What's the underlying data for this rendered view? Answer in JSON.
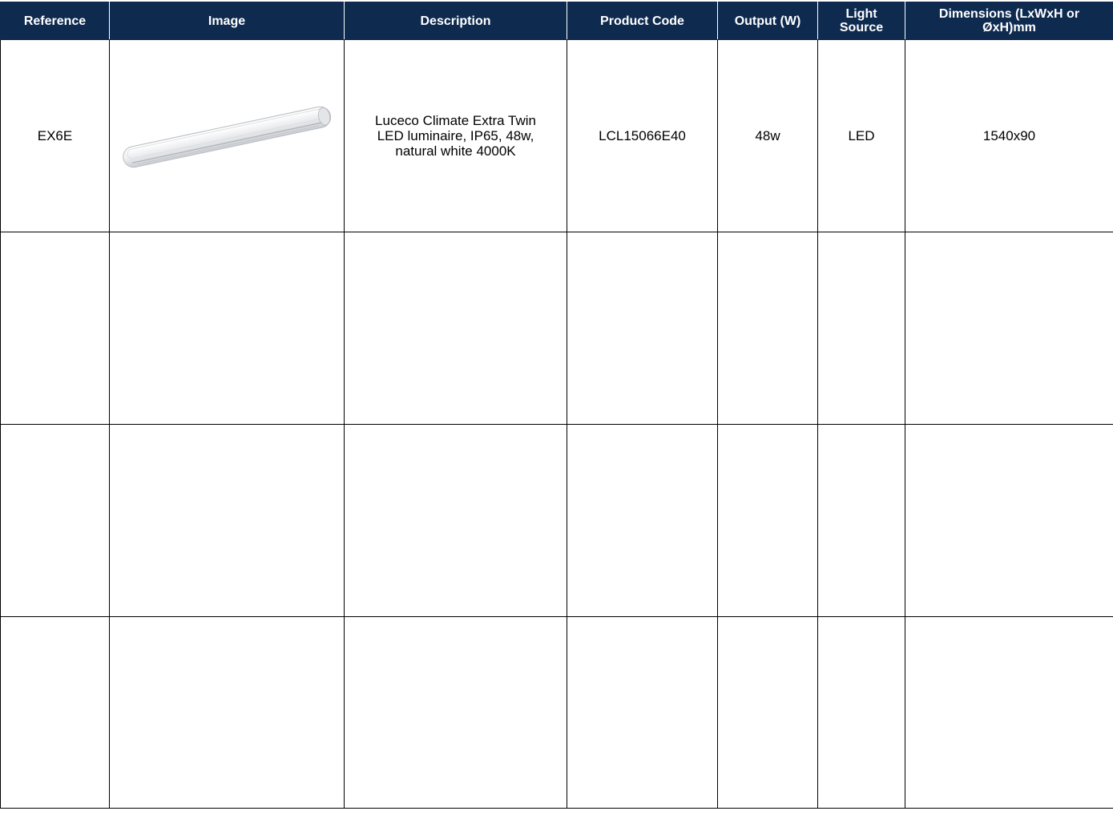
{
  "table": {
    "headers": {
      "reference": "Reference",
      "image": "Image",
      "description": "Description",
      "product_code": "Product Code",
      "output": "Output (W)",
      "light_source_line1": "Light",
      "light_source_line2": "Source",
      "dimensions_line1": "Dimensions (LxWxH or",
      "dimensions_line2": "ØxH)mm"
    },
    "rows": [
      {
        "reference": "EX6E",
        "image": "led-batten-luminaire-image",
        "description_line1": "Luceco Climate Extra Twin",
        "description_line2": "LED luminaire, IP65, 48w,",
        "description_line3": "natural white 4000K",
        "product_code": "LCL15066E40",
        "output": "48w",
        "light_source": "LED",
        "dimensions": "1540x90"
      },
      {
        "reference": "",
        "description_line1": "",
        "description_line2": "",
        "description_line3": "",
        "product_code": "",
        "output": "",
        "light_source": "",
        "dimensions": ""
      },
      {
        "reference": "",
        "description_line1": "",
        "description_line2": "",
        "description_line3": "",
        "product_code": "",
        "output": "",
        "light_source": "",
        "dimensions": ""
      },
      {
        "reference": "",
        "description_line1": "",
        "description_line2": "",
        "description_line3": "",
        "product_code": "",
        "output": "",
        "light_source": "",
        "dimensions": ""
      }
    ]
  },
  "colors": {
    "header_background": "#0e2a4f",
    "header_text": "#ffffff",
    "grid_lines": "#000000"
  }
}
